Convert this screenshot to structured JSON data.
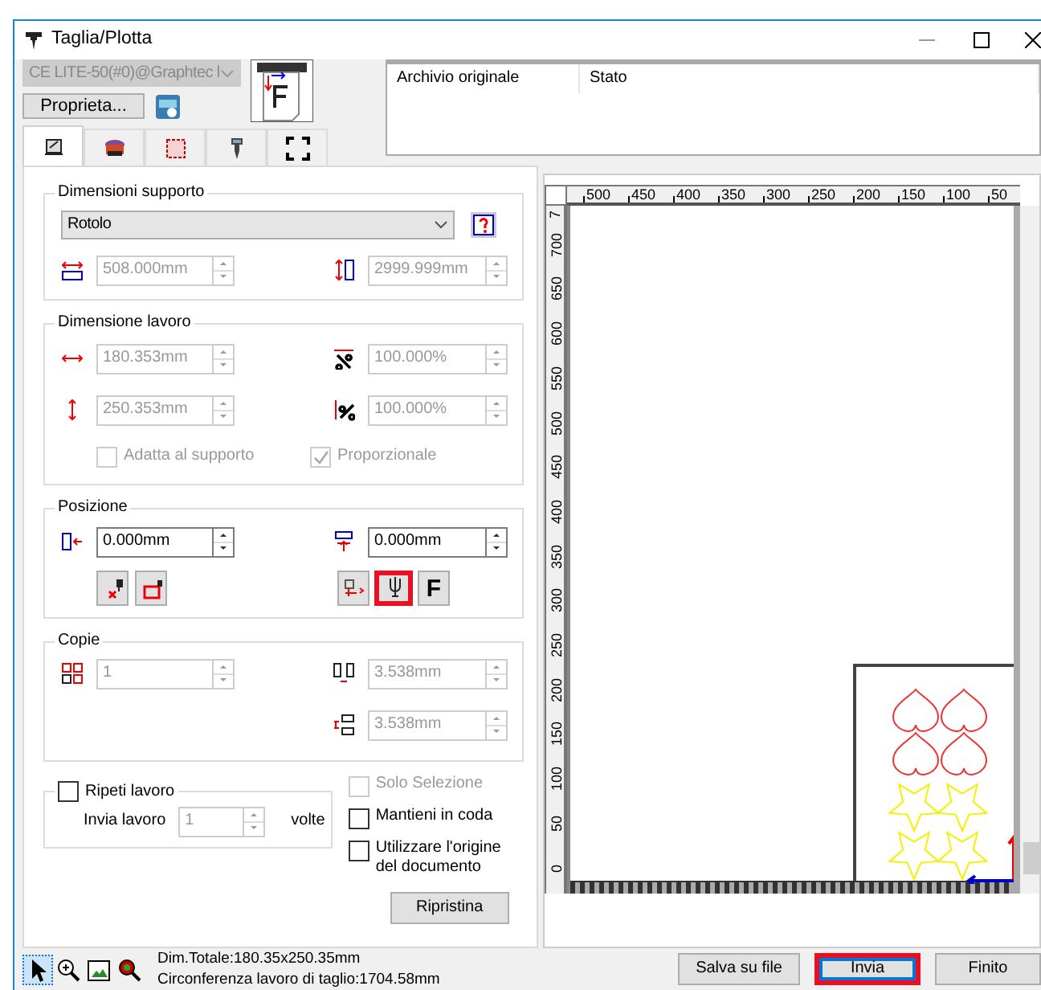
{
  "window": {
    "title": "Taglia/Plotta"
  },
  "device": {
    "value": "CE LITE-50(#0)@Graphtec l",
    "disabled": true
  },
  "properties_button": {
    "label": "Proprieta..."
  },
  "job_list": {
    "columns": [
      "Archivio originale",
      "Stato"
    ]
  },
  "tabs": [
    {
      "selected": true
    },
    {
      "selected": false
    },
    {
      "selected": false
    },
    {
      "selected": false
    },
    {
      "selected": false
    }
  ],
  "media": {
    "title": "Dimensioni supporto",
    "type": "Rotolo",
    "width": {
      "value": "508.000mm",
      "disabled": true
    },
    "length": {
      "value": "2999.999mm",
      "disabled": true
    }
  },
  "job_size": {
    "title": "Dimensione lavoro",
    "width": {
      "value": "180.353mm",
      "disabled": true
    },
    "scale_x": {
      "value": "100.000%",
      "disabled": true
    },
    "height": {
      "value": "250.353mm",
      "disabled": true
    },
    "scale_y": {
      "value": "100.000%",
      "disabled": true
    },
    "checks": [
      {
        "label": "Adatta al supporto",
        "checked": false,
        "disabled": true
      },
      {
        "label": "Proporzionale",
        "checked": true,
        "disabled": true
      }
    ]
  },
  "position": {
    "title": "Posizione",
    "x": {
      "value": "0.000mm",
      "disabled": false
    },
    "y": {
      "value": "0.000mm",
      "disabled": false
    },
    "tools": [
      {
        "highlighted": false
      },
      {
        "highlighted": false
      },
      {
        "highlighted": false
      },
      {
        "highlighted": true
      },
      {
        "label": "F",
        "highlighted": false
      }
    ]
  },
  "copies": {
    "title": "Copie",
    "count": {
      "value": "1",
      "disabled": true
    },
    "gap_x": {
      "value": "3.538mm",
      "disabled": true
    },
    "gap_y": {
      "value": "3.538mm",
      "disabled": true
    }
  },
  "repeat": {
    "label": "Ripeti lavoro",
    "checked": false,
    "send_label": "Invia lavoro",
    "times": {
      "value": "1",
      "disabled": true
    },
    "unit": "volte"
  },
  "options": [
    {
      "label": "Solo Selezione",
      "checked": false,
      "disabled": true
    },
    {
      "label": "Mantieni in coda",
      "checked": false,
      "disabled": false
    },
    {
      "label": "Utilizzare l'origine del documento",
      "checked": false,
      "disabled": false
    }
  ],
  "reset_button": {
    "label": "Ripristina"
  },
  "preview": {
    "x_ruler": [
      "500",
      "450",
      "400",
      "350",
      "300",
      "250",
      "200",
      "150",
      "100",
      "50"
    ],
    "y_ruler": [
      "7",
      "700",
      "650",
      "600",
      "550",
      "500",
      "450",
      "400",
      "350",
      "300",
      "250",
      "200",
      "150",
      "100",
      "50",
      "0"
    ]
  },
  "view_tools": [
    {
      "selected": true
    },
    {
      "selected": false
    },
    {
      "selected": false
    },
    {
      "selected": false
    }
  ],
  "status": [
    "Dim.Totale:180.35x250.35mm",
    "Circonferenza lavoro di taglio:1704.58mm"
  ],
  "buttons": [
    {
      "label": "Salva su file",
      "default": false,
      "highlighted": false
    },
    {
      "label": "Invia",
      "default": true,
      "highlighted": true
    },
    {
      "label": "Finito",
      "default": false,
      "highlighted": false
    }
  ]
}
